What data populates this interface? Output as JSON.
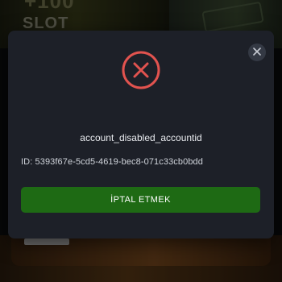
{
  "background": {
    "slot_text": "SLOT",
    "big_text": "+100"
  },
  "modal": {
    "icon": "error-x-icon",
    "icon_color": "#e2534f",
    "title": "account_disabled_accountid",
    "id_text": "ID: 5393f67e-5cd5-4619-bec8-071c33cb0bdd",
    "close_icon": "close-icon",
    "cancel_label": "İPTAL ETMEK",
    "cancel_color": "#1e6a14"
  }
}
